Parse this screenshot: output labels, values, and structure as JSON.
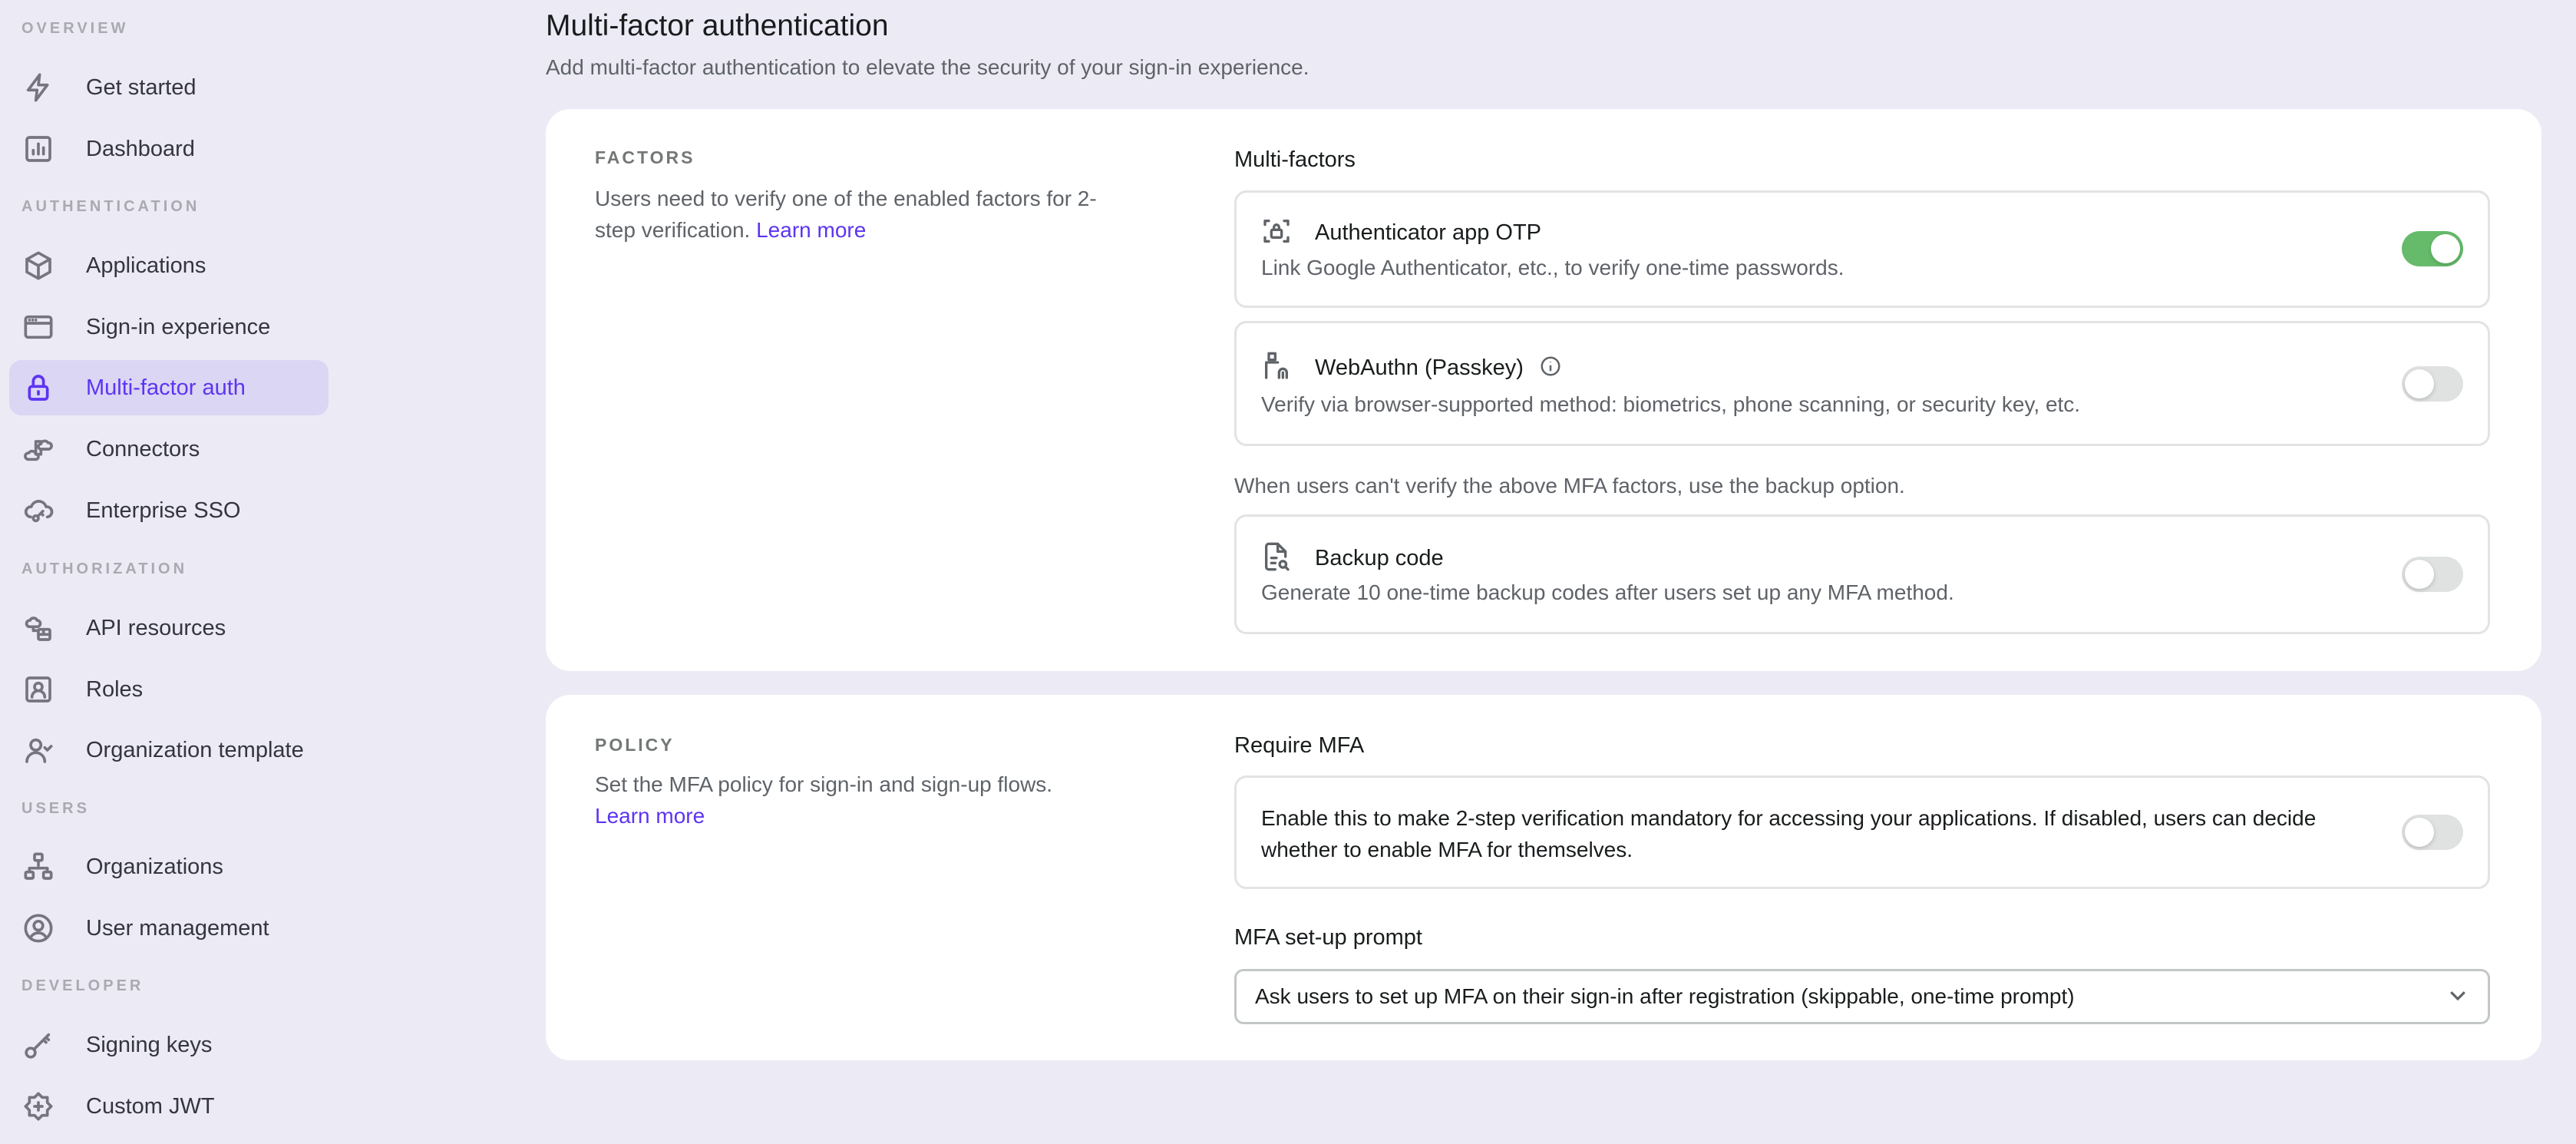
{
  "sidebar": {
    "sections": [
      {
        "title": "OVERVIEW"
      },
      {
        "title": "AUTHENTICATION"
      },
      {
        "title": "AUTHORIZATION"
      },
      {
        "title": "USERS"
      },
      {
        "title": "DEVELOPER"
      }
    ],
    "items": [
      {
        "label": "Get started",
        "icon": "lightning-icon"
      },
      {
        "label": "Dashboard",
        "icon": "chart-icon"
      },
      {
        "label": "Applications",
        "icon": "cube-icon"
      },
      {
        "label": "Sign-in experience",
        "icon": "browser-window-icon"
      },
      {
        "label": "Multi-factor auth",
        "icon": "lock-icon",
        "active": true
      },
      {
        "label": "Connectors",
        "icon": "cloud-connector-icon"
      },
      {
        "label": "Enterprise SSO",
        "icon": "cloud-key-icon"
      },
      {
        "label": "API resources",
        "icon": "cloud-database-icon"
      },
      {
        "label": "Roles",
        "icon": "user-badge-icon"
      },
      {
        "label": "Organization template",
        "icon": "user-check-icon"
      },
      {
        "label": "Organizations",
        "icon": "org-tree-icon"
      },
      {
        "label": "User management",
        "icon": "user-circle-icon"
      },
      {
        "label": "Signing keys",
        "icon": "key-icon"
      },
      {
        "label": "Custom JWT",
        "icon": "badge-plus-icon"
      }
    ]
  },
  "header": {
    "title": "Multi-factor authentication",
    "subtitle": "Add multi-factor authentication to elevate the security of your sign-in experience."
  },
  "factors": {
    "section_title": "FACTORS",
    "description": "Users need to verify one of the enabled factors for 2-step verification.",
    "learn_more": "Learn more",
    "field_label": "Multi-factors",
    "items": [
      {
        "title": "Authenticator app OTP",
        "description": "Link Google Authenticator, etc., to verify one-time passwords.",
        "enabled": true
      },
      {
        "title": "WebAuthn (Passkey)",
        "description": "Verify via browser-supported method: biometrics, phone scanning, or security key, etc.",
        "enabled": false
      }
    ],
    "backup_hint": "When users can't verify the above MFA factors, use the backup option.",
    "backup": {
      "title": "Backup code",
      "description": "Generate 10 one-time backup codes after users set up any MFA method.",
      "enabled": false
    }
  },
  "policy": {
    "section_title": "POLICY",
    "description": "Set the MFA policy for sign-in and sign-up flows.",
    "learn_more": "Learn more",
    "require_label": "Require MFA",
    "require_text": "Enable this to make 2-step verification mandatory for accessing your applications. If disabled, users can decide whether to enable MFA for themselves.",
    "require_enabled": false,
    "prompt_label": "MFA set-up prompt",
    "prompt_value": "Ask users to set up MFA on their sign-in after registration (skippable, one-time prompt)"
  },
  "colors": {
    "accent": "#5d34f2",
    "toggle_on": "#66bb6a",
    "background": "#ecebf5"
  }
}
